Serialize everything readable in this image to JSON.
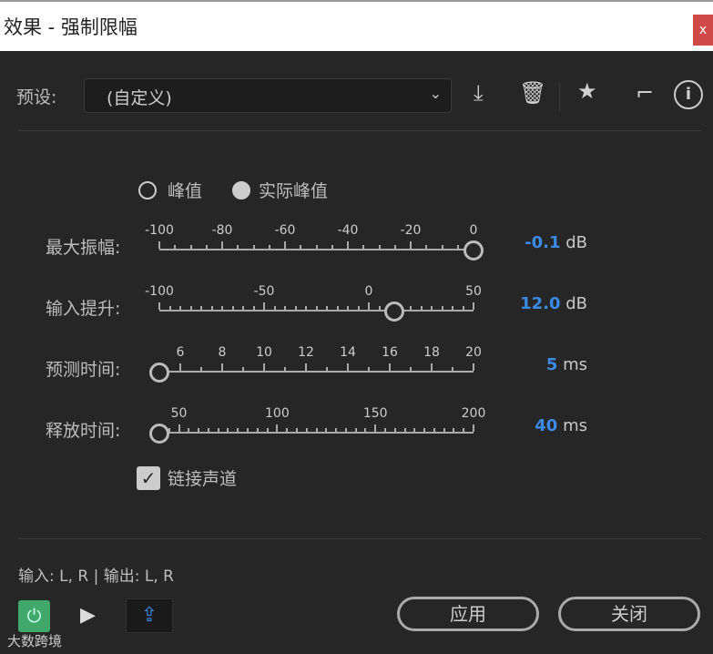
{
  "window": {
    "title": "效果 - 强制限幅",
    "close": "x"
  },
  "preset": {
    "label": "预设:",
    "value": "(自定义)"
  },
  "mode": {
    "options": [
      "峰值",
      "实际峰值"
    ],
    "selected": 1
  },
  "sliders": [
    {
      "label": "最大振幅:",
      "min": -100,
      "max": 0,
      "ticks": [
        -100,
        -80,
        -60,
        -40,
        -20,
        0
      ],
      "minor": 5,
      "value": -0.1,
      "value_text": "-0.1",
      "unit": "dB"
    },
    {
      "label": "输入提升:",
      "min": -100,
      "max": 50,
      "ticks": [
        -100,
        -50,
        0,
        50
      ],
      "minor": 5,
      "value": 12,
      "value_text": "12.0",
      "unit": "dB"
    },
    {
      "label": "预测时间:",
      "min": 5,
      "max": 20,
      "ticks": [
        6,
        8,
        10,
        12,
        14,
        16,
        18,
        20
      ],
      "minor": 1,
      "value": 5,
      "value_text": "5",
      "unit": "ms"
    },
    {
      "label": "释放时间:",
      "min": 40,
      "max": 200,
      "ticks": [
        50,
        100,
        150,
        200
      ],
      "minor": 5,
      "value": 40,
      "value_text": "40",
      "unit": "ms"
    }
  ],
  "link": {
    "label": "链接声道",
    "checked": true
  },
  "io": "输入: L, R | 输出: L, R",
  "buttons": {
    "apply": "应用",
    "close": "关闭"
  },
  "watermark": "大数跨境",
  "colors": {
    "accent": "#3b8ae6",
    "power": "#3fa86a"
  }
}
